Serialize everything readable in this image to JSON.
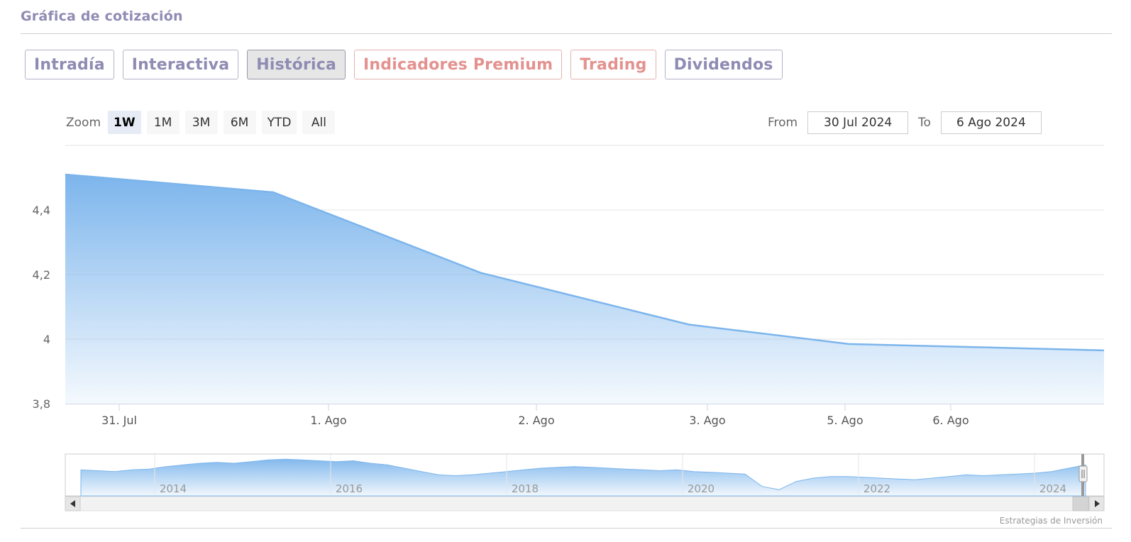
{
  "header": {
    "title": "Gráfica de cotización"
  },
  "tabs": [
    {
      "label": "Intradía",
      "active": false,
      "premium": false
    },
    {
      "label": "Interactiva",
      "active": false,
      "premium": false
    },
    {
      "label": "Histórica",
      "active": true,
      "premium": false
    },
    {
      "label": "Indicadores Premium",
      "active": false,
      "premium": true
    },
    {
      "label": "Trading",
      "active": false,
      "premium": true
    },
    {
      "label": "Dividendos",
      "active": false,
      "premium": false
    }
  ],
  "zoom": {
    "label": "Zoom",
    "options": [
      "1W",
      "1M",
      "3M",
      "6M",
      "YTD",
      "All"
    ],
    "selected": "1W"
  },
  "range": {
    "from_label": "From",
    "from_value": "30 Jul 2024",
    "to_label": "To",
    "to_value": "6 Ago 2024"
  },
  "colors": {
    "series": "#7cb5ec",
    "accent": "#8f8bb3",
    "premium": "#e3928f"
  },
  "chart_data": {
    "type": "area",
    "x": [
      "2024-07-30",
      "2024-07-31",
      "2024-08-01",
      "2024-08-02",
      "2024-08-05",
      "2024-08-06"
    ],
    "values": [
      4.51,
      4.455,
      4.205,
      4.045,
      3.985,
      3.965
    ],
    "ylim": [
      3.8,
      4.6
    ],
    "yticks": [
      3.8,
      4.0,
      4.2,
      4.4
    ],
    "ytick_labels": [
      "3,8",
      "4",
      "4,2",
      "4,4"
    ],
    "xticks": [
      {
        "x": "2024-07-31",
        "label": "31. Jul"
      },
      {
        "x": "2024-08-01",
        "label": "1. Ago"
      },
      {
        "x": "2024-08-02",
        "label": "2. Ago"
      },
      {
        "x": "2024-08-05",
        "label": "3. Ago"
      },
      {
        "x": "2024-08-05",
        "label": "5. Ago"
      },
      {
        "x": "2024-08-06",
        "label": "6. Ago"
      }
    ],
    "grid": true,
    "navigator": {
      "labels": [
        "2014",
        "2016",
        "2018",
        "2020",
        "2022",
        "2024"
      ],
      "series": [
        3.9,
        3.85,
        3.8,
        3.9,
        3.95,
        4.1,
        4.2,
        4.3,
        4.35,
        4.3,
        4.4,
        4.5,
        4.55,
        4.5,
        4.45,
        4.4,
        4.45,
        4.3,
        4.2,
        4.0,
        3.8,
        3.6,
        3.55,
        3.6,
        3.7,
        3.8,
        3.9,
        4.0,
        4.05,
        4.1,
        4.05,
        4.0,
        3.95,
        3.9,
        3.85,
        3.9,
        3.8,
        3.75,
        3.7,
        3.65,
        2.9,
        2.7,
        3.2,
        3.4,
        3.5,
        3.5,
        3.45,
        3.4,
        3.35,
        3.3,
        3.4,
        3.5,
        3.6,
        3.55,
        3.6,
        3.65,
        3.7,
        3.8,
        4.0,
        4.2
      ]
    },
    "credit": "Estrategias de Inversión"
  }
}
